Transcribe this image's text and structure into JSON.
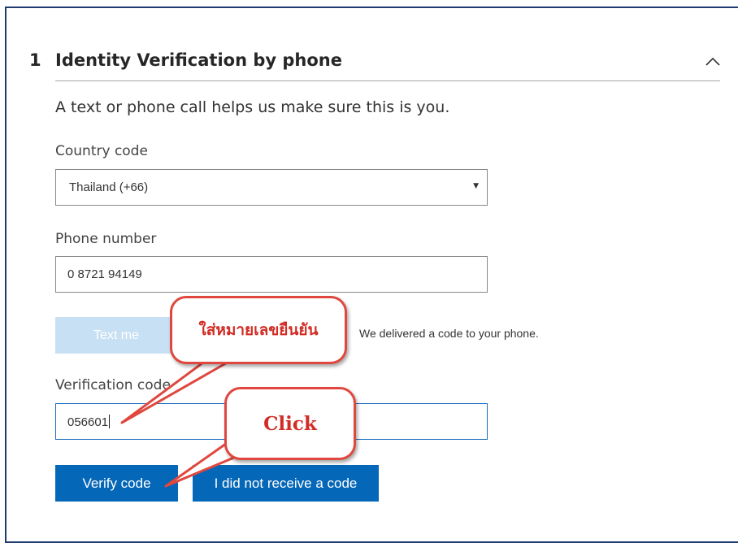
{
  "section": {
    "number": "1",
    "title": "Identity Verification by phone",
    "collapse_icon": "chevron-up-icon"
  },
  "intro_text": "A text or phone call helps us make sure this is you.",
  "country": {
    "label": "Country code",
    "value": "Thailand (+66)",
    "caret_icon": "dropdown-caret-icon"
  },
  "phone": {
    "label": "Phone number",
    "value": "0 8721 94149"
  },
  "text_me_button": "Text me",
  "delivery_status": "We delivered a code to your phone.",
  "verification": {
    "label": "Verification code",
    "value": "056601"
  },
  "buttons": {
    "verify": "Verify code",
    "not_received": "I did not receive a code"
  },
  "annotations": {
    "enter_code": "ใส่หมายเลขยืนยัน",
    "click": "Click"
  },
  "colors": {
    "primary": "#0567b8",
    "disabled": "#c7e0f4",
    "callout_border": "#e0473e",
    "callout_text": "#d12d25",
    "frame": "#1f3b6f"
  }
}
